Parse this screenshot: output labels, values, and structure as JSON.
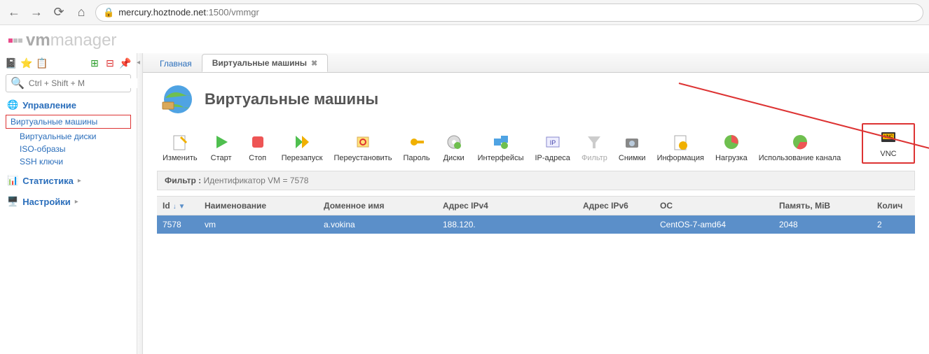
{
  "browser": {
    "url_host": "mercury.hoztnode.net",
    "url_port": ":1500",
    "url_path": "/vmmgr"
  },
  "logo": {
    "prefix": "vm",
    "suffix": "manager"
  },
  "sidebar": {
    "search_placeholder": "Ctrl + Shift + M",
    "sections": {
      "manage": {
        "title": "Управление",
        "items": [
          "Виртуальные машины",
          "Виртуальные диски",
          "ISO-образы",
          "SSH ключи"
        ]
      },
      "stats": {
        "title": "Статистика"
      },
      "settings": {
        "title": "Настройки"
      }
    }
  },
  "tabs": {
    "home": "Главная",
    "vms": "Виртуальные машины"
  },
  "page": {
    "title": "Виртуальные машины"
  },
  "actions": {
    "edit": "Изменить",
    "start": "Старт",
    "stop": "Стоп",
    "restart": "Перезапуск",
    "reinstall": "Переустановить",
    "password": "Пароль",
    "disks": "Диски",
    "interfaces": "Интерфейсы",
    "ip": "IP-адреса",
    "filter": "Фильтр",
    "snapshots": "Снимки",
    "info": "Информация",
    "load": "Нагрузка",
    "channel": "Использование канала",
    "vnc": "VNC"
  },
  "filter": {
    "label": "Фильтр : ",
    "text": "Идентификатор VM = 7578"
  },
  "columns": [
    "Id",
    "Наименование",
    "Доменное имя",
    "Адрес IPv4",
    "Адрес IPv6",
    "ОС",
    "Память, MiB",
    "Колич"
  ],
  "rows": [
    {
      "id": "7578",
      "name": "vm",
      "domain": "a.vokina",
      "ipv4": "188.120.",
      "ipv6": "",
      "os": "CentOS-7-amd64",
      "mem": "2048",
      "count": "2"
    }
  ]
}
